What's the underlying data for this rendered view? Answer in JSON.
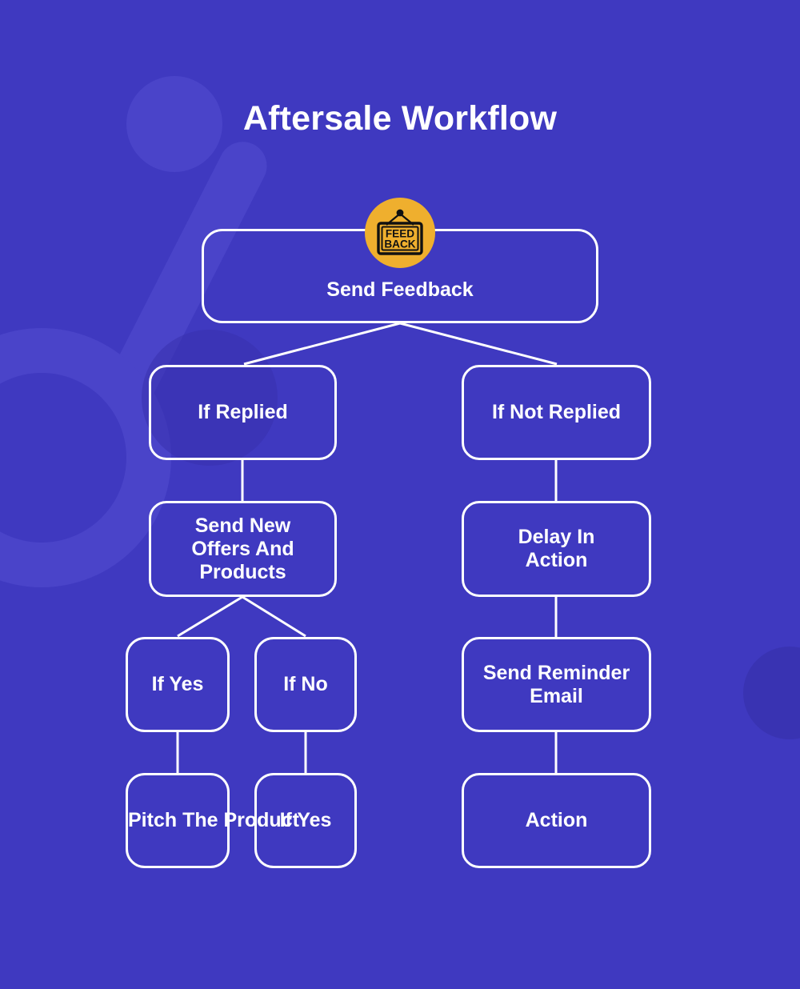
{
  "title": "Aftersale Workflow",
  "colors": {
    "background": "#3f39c0",
    "decor_light": "#4a44c9",
    "decor_dark": "#3832ad",
    "node_border": "#ffffff",
    "text": "#ffffff",
    "badge": "#efaf2e",
    "badge_mark": "#111111"
  },
  "badge": {
    "icon": "feedback-sign-icon",
    "line1": "FEED",
    "line2": "BACK"
  },
  "nodes": {
    "root": "Send Feedback",
    "replied": "If Replied",
    "not_replied": "If Not Replied",
    "offers": "Send New\nOffers And\nProducts",
    "delay": "Delay In\nAction",
    "if_yes_1": "If Yes",
    "if_no": "If No",
    "reminder": "Send Reminder\nEmail",
    "pitch": "Pitch The\nProduct",
    "if_yes_2": "If Yes",
    "action": "Action"
  },
  "flow": [
    {
      "from": "root",
      "to": "replied"
    },
    {
      "from": "root",
      "to": "not_replied"
    },
    {
      "from": "replied",
      "to": "offers"
    },
    {
      "from": "not_replied",
      "to": "delay"
    },
    {
      "from": "offers",
      "to": "if_yes_1"
    },
    {
      "from": "offers",
      "to": "if_no"
    },
    {
      "from": "delay",
      "to": "reminder"
    },
    {
      "from": "if_yes_1",
      "to": "pitch"
    },
    {
      "from": "if_no",
      "to": "if_yes_2"
    },
    {
      "from": "reminder",
      "to": "action"
    }
  ]
}
